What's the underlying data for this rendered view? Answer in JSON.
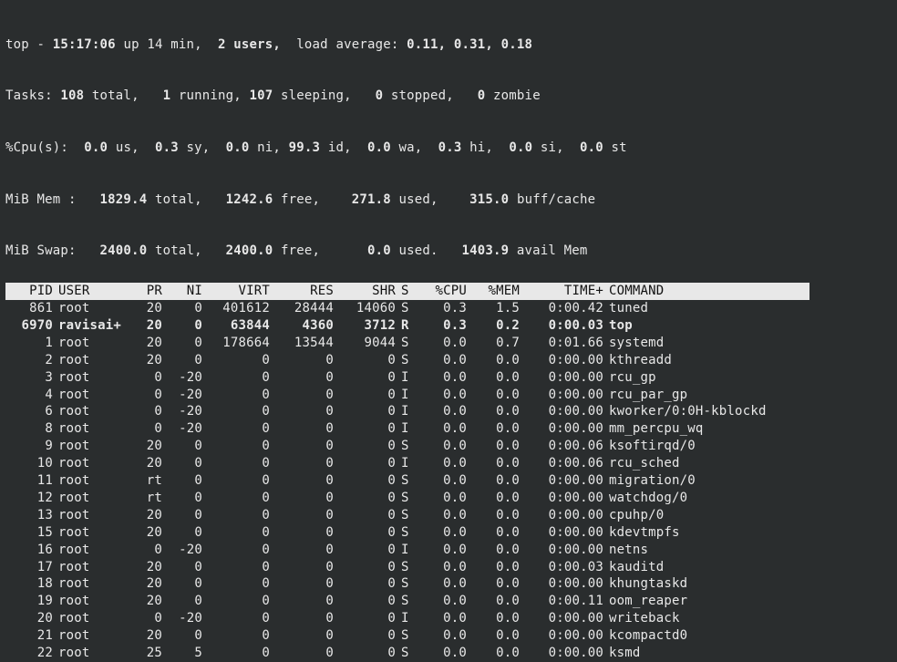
{
  "summary": {
    "line1_a": "top - ",
    "line1_b": "15:17:06 ",
    "line1_c": "up 14 min,  ",
    "line1_d": "2 users, ",
    "line1_e": " load average: ",
    "line1_f": "0.11, 0.31, 0.18",
    "tasks_a": "Tasks: ",
    "tasks_b": "108 ",
    "tasks_c": "total,   ",
    "tasks_d": "1 ",
    "tasks_e": "running, ",
    "tasks_f": "107 ",
    "tasks_g": "sleeping,   ",
    "tasks_h": "0 ",
    "tasks_i": "stopped,   ",
    "tasks_j": "0 ",
    "tasks_k": "zombie",
    "cpu_a": "%Cpu(s):  ",
    "cpu_b": "0.0 ",
    "cpu_c": "us,  ",
    "cpu_d": "0.3 ",
    "cpu_e": "sy,  ",
    "cpu_f": "0.0 ",
    "cpu_g": "ni, ",
    "cpu_h": "99.3 ",
    "cpu_i": "id,  ",
    "cpu_j": "0.0 ",
    "cpu_k": "wa,  ",
    "cpu_l": "0.3 ",
    "cpu_m": "hi,  ",
    "cpu_n": "0.0 ",
    "cpu_o": "si,  ",
    "cpu_p": "0.0 ",
    "cpu_q": "st",
    "mem_a": "MiB Mem :   ",
    "mem_b": "1829.4 ",
    "mem_c": "total,   ",
    "mem_d": "1242.6 ",
    "mem_e": "free,    ",
    "mem_f": "271.8 ",
    "mem_g": "used,    ",
    "mem_h": "315.0 ",
    "mem_i": "buff/cache",
    "swap_a": "MiB Swap:   ",
    "swap_b": "2400.0 ",
    "swap_c": "total,   ",
    "swap_d": "2400.0 ",
    "swap_e": "free,      ",
    "swap_f": "0.0 ",
    "swap_g": "used.   ",
    "swap_h": "1403.9 ",
    "swap_i": "avail Mem"
  },
  "columns": {
    "pid": "PID",
    "user": "USER",
    "pr": "PR",
    "ni": "NI",
    "virt": "VIRT",
    "res": "RES",
    "shr": "SHR",
    "s": "S",
    "cpu": "%CPU",
    "mem": "%MEM",
    "time": "TIME+",
    "cmd": "COMMAND"
  },
  "procs": [
    {
      "pid": "861",
      "user": "root",
      "pr": "20",
      "ni": "0",
      "virt": "401612",
      "res": "28444",
      "shr": "14060",
      "s": "S",
      "cpu": "0.3",
      "mem": "1.5",
      "time": "0:00.42",
      "cmd": "tuned",
      "bold": false
    },
    {
      "pid": "6970",
      "user": "ravisai+",
      "pr": "20",
      "ni": "0",
      "virt": "63844",
      "res": "4360",
      "shr": "3712",
      "s": "R",
      "cpu": "0.3",
      "mem": "0.2",
      "time": "0:00.03",
      "cmd": "top",
      "bold": true
    },
    {
      "pid": "1",
      "user": "root",
      "pr": "20",
      "ni": "0",
      "virt": "178664",
      "res": "13544",
      "shr": "9044",
      "s": "S",
      "cpu": "0.0",
      "mem": "0.7",
      "time": "0:01.66",
      "cmd": "systemd",
      "bold": false
    },
    {
      "pid": "2",
      "user": "root",
      "pr": "20",
      "ni": "0",
      "virt": "0",
      "res": "0",
      "shr": "0",
      "s": "S",
      "cpu": "0.0",
      "mem": "0.0",
      "time": "0:00.00",
      "cmd": "kthreadd",
      "bold": false
    },
    {
      "pid": "3",
      "user": "root",
      "pr": "0",
      "ni": "-20",
      "virt": "0",
      "res": "0",
      "shr": "0",
      "s": "I",
      "cpu": "0.0",
      "mem": "0.0",
      "time": "0:00.00",
      "cmd": "rcu_gp",
      "bold": false
    },
    {
      "pid": "4",
      "user": "root",
      "pr": "0",
      "ni": "-20",
      "virt": "0",
      "res": "0",
      "shr": "0",
      "s": "I",
      "cpu": "0.0",
      "mem": "0.0",
      "time": "0:00.00",
      "cmd": "rcu_par_gp",
      "bold": false
    },
    {
      "pid": "6",
      "user": "root",
      "pr": "0",
      "ni": "-20",
      "virt": "0",
      "res": "0",
      "shr": "0",
      "s": "I",
      "cpu": "0.0",
      "mem": "0.0",
      "time": "0:00.00",
      "cmd": "kworker/0:0H-kblockd",
      "bold": false
    },
    {
      "pid": "8",
      "user": "root",
      "pr": "0",
      "ni": "-20",
      "virt": "0",
      "res": "0",
      "shr": "0",
      "s": "I",
      "cpu": "0.0",
      "mem": "0.0",
      "time": "0:00.00",
      "cmd": "mm_percpu_wq",
      "bold": false
    },
    {
      "pid": "9",
      "user": "root",
      "pr": "20",
      "ni": "0",
      "virt": "0",
      "res": "0",
      "shr": "0",
      "s": "S",
      "cpu": "0.0",
      "mem": "0.0",
      "time": "0:00.06",
      "cmd": "ksoftirqd/0",
      "bold": false
    },
    {
      "pid": "10",
      "user": "root",
      "pr": "20",
      "ni": "0",
      "virt": "0",
      "res": "0",
      "shr": "0",
      "s": "I",
      "cpu": "0.0",
      "mem": "0.0",
      "time": "0:00.06",
      "cmd": "rcu_sched",
      "bold": false
    },
    {
      "pid": "11",
      "user": "root",
      "pr": "rt",
      "ni": "0",
      "virt": "0",
      "res": "0",
      "shr": "0",
      "s": "S",
      "cpu": "0.0",
      "mem": "0.0",
      "time": "0:00.00",
      "cmd": "migration/0",
      "bold": false
    },
    {
      "pid": "12",
      "user": "root",
      "pr": "rt",
      "ni": "0",
      "virt": "0",
      "res": "0",
      "shr": "0",
      "s": "S",
      "cpu": "0.0",
      "mem": "0.0",
      "time": "0:00.00",
      "cmd": "watchdog/0",
      "bold": false
    },
    {
      "pid": "13",
      "user": "root",
      "pr": "20",
      "ni": "0",
      "virt": "0",
      "res": "0",
      "shr": "0",
      "s": "S",
      "cpu": "0.0",
      "mem": "0.0",
      "time": "0:00.00",
      "cmd": "cpuhp/0",
      "bold": false
    },
    {
      "pid": "15",
      "user": "root",
      "pr": "20",
      "ni": "0",
      "virt": "0",
      "res": "0",
      "shr": "0",
      "s": "S",
      "cpu": "0.0",
      "mem": "0.0",
      "time": "0:00.00",
      "cmd": "kdevtmpfs",
      "bold": false
    },
    {
      "pid": "16",
      "user": "root",
      "pr": "0",
      "ni": "-20",
      "virt": "0",
      "res": "0",
      "shr": "0",
      "s": "I",
      "cpu": "0.0",
      "mem": "0.0",
      "time": "0:00.00",
      "cmd": "netns",
      "bold": false
    },
    {
      "pid": "17",
      "user": "root",
      "pr": "20",
      "ni": "0",
      "virt": "0",
      "res": "0",
      "shr": "0",
      "s": "S",
      "cpu": "0.0",
      "mem": "0.0",
      "time": "0:00.03",
      "cmd": "kauditd",
      "bold": false
    },
    {
      "pid": "18",
      "user": "root",
      "pr": "20",
      "ni": "0",
      "virt": "0",
      "res": "0",
      "shr": "0",
      "s": "S",
      "cpu": "0.0",
      "mem": "0.0",
      "time": "0:00.00",
      "cmd": "khungtaskd",
      "bold": false
    },
    {
      "pid": "19",
      "user": "root",
      "pr": "20",
      "ni": "0",
      "virt": "0",
      "res": "0",
      "shr": "0",
      "s": "S",
      "cpu": "0.0",
      "mem": "0.0",
      "time": "0:00.11",
      "cmd": "oom_reaper",
      "bold": false
    },
    {
      "pid": "20",
      "user": "root",
      "pr": "0",
      "ni": "-20",
      "virt": "0",
      "res": "0",
      "shr": "0",
      "s": "I",
      "cpu": "0.0",
      "mem": "0.0",
      "time": "0:00.00",
      "cmd": "writeback",
      "bold": false
    },
    {
      "pid": "21",
      "user": "root",
      "pr": "20",
      "ni": "0",
      "virt": "0",
      "res": "0",
      "shr": "0",
      "s": "S",
      "cpu": "0.0",
      "mem": "0.0",
      "time": "0:00.00",
      "cmd": "kcompactd0",
      "bold": false
    },
    {
      "pid": "22",
      "user": "root",
      "pr": "25",
      "ni": "5",
      "virt": "0",
      "res": "0",
      "shr": "0",
      "s": "S",
      "cpu": "0.0",
      "mem": "0.0",
      "time": "0:00.00",
      "cmd": "ksmd",
      "bold": false
    }
  ]
}
